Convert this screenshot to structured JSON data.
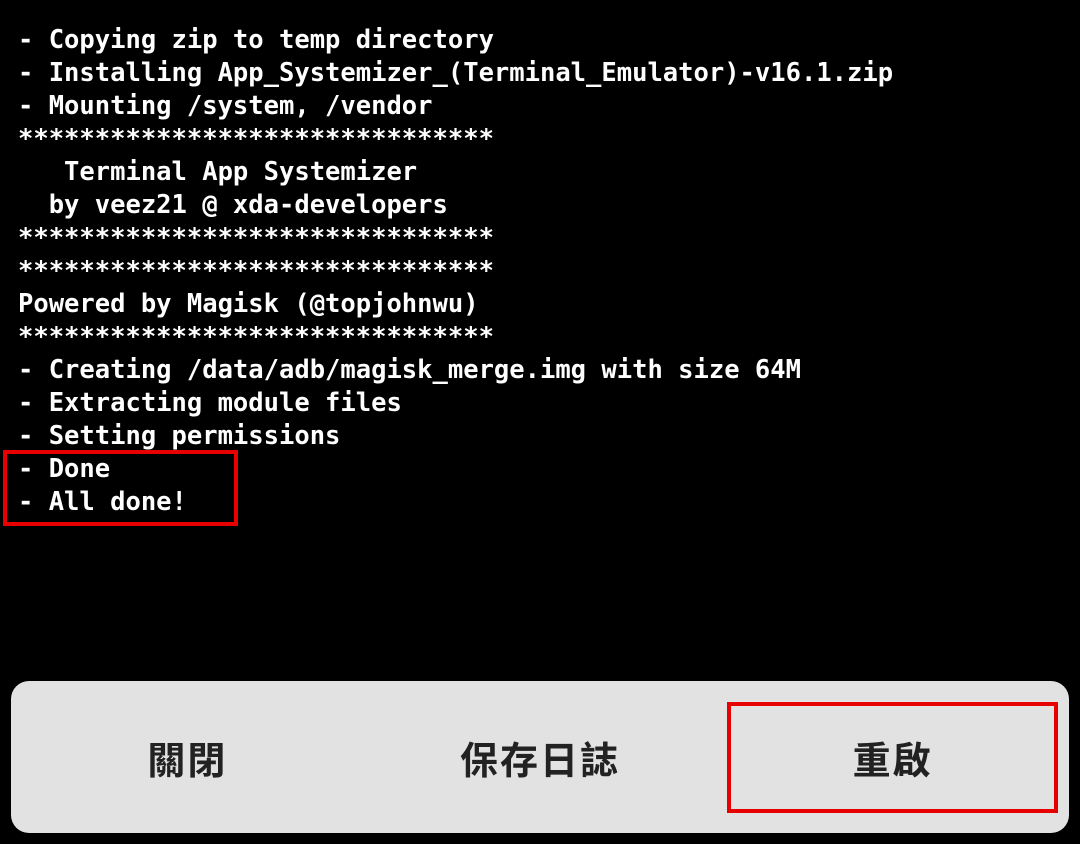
{
  "terminal": {
    "lines": [
      "- Copying zip to temp directory",
      "- Installing App_Systemizer_(Terminal_Emulator)-v16.1.zip",
      "- Mounting /system, /vendor",
      "*******************************",
      "   Terminal App Systemizer",
      "  by veez21 @ xda-developers",
      "*******************************",
      "*******************************",
      "Powered by Magisk (@topjohnwu)",
      "*******************************",
      "- Creating /data/adb/magisk_merge.img with size 64M",
      "- Extracting module files",
      "- Setting permissions",
      "- Done",
      "- All done!"
    ]
  },
  "buttons": {
    "close": "關閉",
    "save_log": "保存日誌",
    "reboot": "重啟"
  }
}
